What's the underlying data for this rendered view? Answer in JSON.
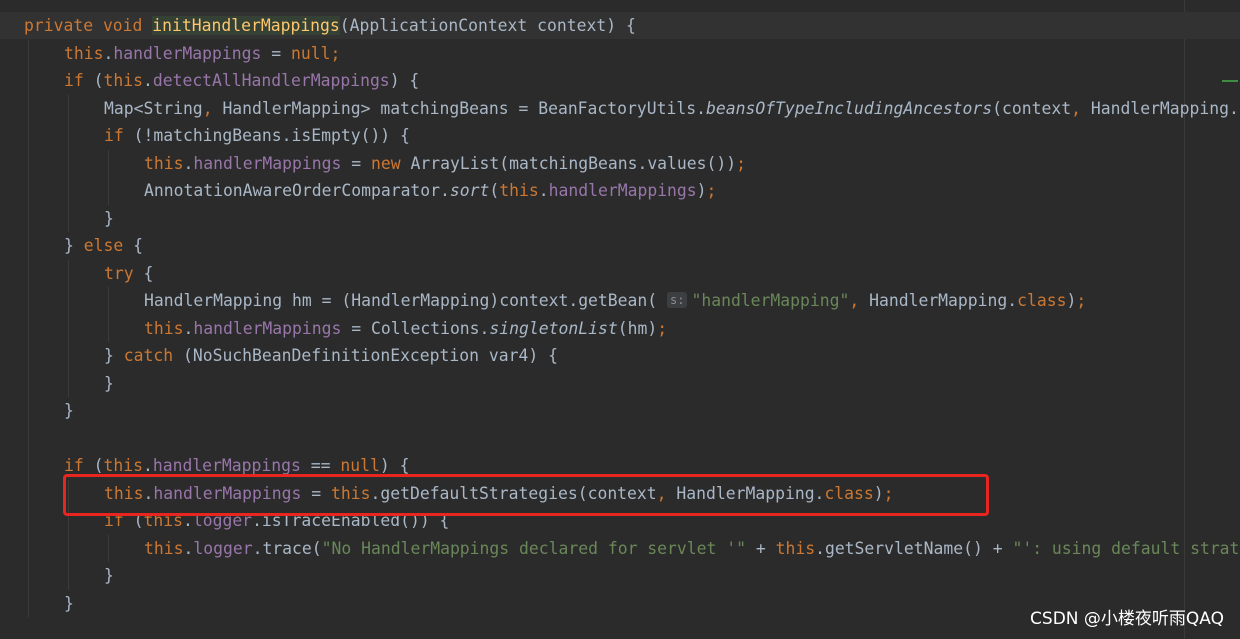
{
  "editor": {
    "lines": [
      [
        [
          "kw",
          "private void "
        ],
        [
          "fn",
          "initHandlerMappings"
        ],
        [
          "t",
          "(ApplicationContext context) {"
        ]
      ],
      [
        [
          "kw",
          "this"
        ],
        [
          "t",
          "."
        ],
        [
          "fld",
          "handlerMappings"
        ],
        [
          "t",
          " = "
        ],
        [
          "kw",
          "null;"
        ]
      ],
      [
        [
          "kw",
          "if "
        ],
        [
          "t",
          "("
        ],
        [
          "kw",
          "this"
        ],
        [
          "t",
          "."
        ],
        [
          "fld",
          "detectAllHandlerMappings"
        ],
        [
          "t",
          ") {"
        ]
      ],
      [
        [
          "t",
          "Map<String"
        ],
        [
          "kw",
          ", "
        ],
        [
          "t",
          "HandlerMapping> matchingBeans = BeanFactoryUtils."
        ],
        [
          "st",
          "beansOfTypeIncludingAncestors"
        ],
        [
          "t",
          "(context"
        ],
        [
          "kw",
          ", "
        ],
        [
          "t",
          "HandlerMapping.class"
        ]
      ],
      [
        [
          "kw",
          "if "
        ],
        [
          "t",
          "(!matchingBeans.isEmpty()) {"
        ]
      ],
      [
        [
          "kw",
          "this"
        ],
        [
          "t",
          "."
        ],
        [
          "fld",
          "handlerMappings"
        ],
        [
          "t",
          " = "
        ],
        [
          "kw",
          "new "
        ],
        [
          "t",
          "ArrayList(matchingBeans.values())"
        ],
        [
          "kw",
          ";"
        ]
      ],
      [
        [
          "t",
          "AnnotationAwareOrderComparator."
        ],
        [
          "st",
          "sort"
        ],
        [
          "t",
          "("
        ],
        [
          "kw",
          "this"
        ],
        [
          "t",
          "."
        ],
        [
          "fld",
          "handlerMappings"
        ],
        [
          "t",
          ")"
        ],
        [
          "kw",
          ";"
        ]
      ],
      [
        [
          "t",
          "}"
        ]
      ],
      [
        [
          "t",
          "} "
        ],
        [
          "kw",
          "else "
        ],
        [
          "t",
          "{"
        ]
      ],
      [
        [
          "kw",
          "try "
        ],
        [
          "t",
          "{"
        ]
      ],
      [
        [
          "t",
          "HandlerMapping hm = (HandlerMapping)context.getBean( "
        ],
        [
          "hint",
          "s:"
        ],
        [
          "str",
          "\"handlerMapping\""
        ],
        [
          "kw",
          ", "
        ],
        [
          "t",
          "HandlerMapping."
        ],
        [
          "kw",
          "class"
        ],
        [
          "t",
          ")"
        ],
        [
          "kw",
          ";"
        ]
      ],
      [
        [
          "kw",
          "this"
        ],
        [
          "t",
          "."
        ],
        [
          "fld",
          "handlerMappings"
        ],
        [
          "t",
          " = Collections."
        ],
        [
          "st",
          "singletonList"
        ],
        [
          "t",
          "(hm)"
        ],
        [
          "kw",
          ";"
        ]
      ],
      [
        [
          "t",
          "} "
        ],
        [
          "kw",
          "catch "
        ],
        [
          "t",
          "(NoSuchBeanDefinitionException var4) {"
        ]
      ],
      [
        [
          "t",
          "}"
        ]
      ],
      [
        [
          "t",
          "}"
        ]
      ],
      [],
      [
        [
          "kw",
          "if "
        ],
        [
          "t",
          "("
        ],
        [
          "kw",
          "this"
        ],
        [
          "t",
          "."
        ],
        [
          "fld",
          "handlerMappings"
        ],
        [
          "t",
          " == "
        ],
        [
          "kw",
          "null"
        ],
        [
          "t",
          ") {"
        ]
      ],
      [
        [
          "kw",
          "this"
        ],
        [
          "t",
          "."
        ],
        [
          "fld",
          "handlerMappings"
        ],
        [
          "t",
          " = "
        ],
        [
          "kw",
          "this"
        ],
        [
          "t",
          ".getDefaultStrategies(context"
        ],
        [
          "kw",
          ", "
        ],
        [
          "t",
          "HandlerMapping."
        ],
        [
          "kw",
          "class"
        ],
        [
          "t",
          ")"
        ],
        [
          "kw",
          ";"
        ]
      ],
      [
        [
          "kw",
          "if "
        ],
        [
          "t",
          "("
        ],
        [
          "kw",
          "this"
        ],
        [
          "t",
          "."
        ],
        [
          "fld",
          "logger"
        ],
        [
          "t",
          ".isTraceEnabled()) {"
        ]
      ],
      [
        [
          "kw",
          "this"
        ],
        [
          "t",
          "."
        ],
        [
          "fld",
          "logger"
        ],
        [
          "t",
          ".trace("
        ],
        [
          "str",
          "\"No HandlerMappings declared for servlet '\""
        ],
        [
          "t",
          " + "
        ],
        [
          "kw",
          "this"
        ],
        [
          "t",
          ".getServletName() + "
        ],
        [
          "str",
          "\"': using default strategies"
        ]
      ],
      [
        [
          "t",
          "}"
        ]
      ],
      [
        [
          "t",
          "}"
        ]
      ]
    ],
    "indents": [
      0,
      1,
      1,
      2,
      2,
      3,
      3,
      2,
      1,
      2,
      3,
      3,
      2,
      2,
      1,
      0,
      1,
      2,
      2,
      3,
      2,
      1
    ]
  },
  "watermark": "CSDN @小楼夜听雨QAQ",
  "colors": {
    "background": "#2b2b2b",
    "keyword": "#cc7832",
    "field": "#9876aa",
    "string": "#6a8759",
    "method_decl": "#ffc66d",
    "text": "#a9b7c6",
    "highlight_box": "#e8251e"
  }
}
